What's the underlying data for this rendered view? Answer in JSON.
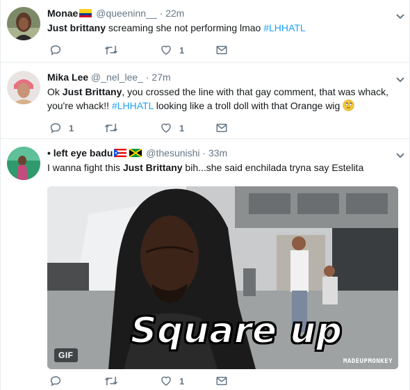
{
  "colors": {
    "accent": "#1da1f2",
    "secondary_text": "#657786",
    "divider": "#e6ecf0"
  },
  "tweets": [
    {
      "name": "Monae",
      "name_flag": "colombia-flag",
      "handle": "@queeninn__",
      "separator": "·",
      "time": "22m",
      "text_parts": [
        {
          "bold": "Just brittany"
        },
        {
          "plain": " screaming she not performing lmao "
        },
        {
          "hashtag": "#LHHATL"
        }
      ],
      "actions": {
        "reply_count": "",
        "retweet_count": "",
        "like_count": "1"
      }
    },
    {
      "name": "Mika Lee",
      "handle": "@_nel_lee_",
      "separator": "·",
      "time": "27m",
      "text_parts": [
        {
          "plain": "Ok "
        },
        {
          "bold": "Just Brittany"
        },
        {
          "plain": ", you crossed the line with that gay comment, that was whack, you're whack!! "
        },
        {
          "hashtag": "#LHHATL"
        },
        {
          "plain": " looking like a troll doll with that Orange wig "
        }
      ],
      "emoji": "face-with-rolling-eyes-emoji",
      "actions": {
        "reply_count": "1",
        "retweet_count": "",
        "like_count": "1"
      }
    },
    {
      "name": "• left eye badu",
      "name_flags": [
        "puerto-rico-flag",
        "jamaica-flag"
      ],
      "handle": "@thesunishi",
      "separator": "·",
      "time": "33m",
      "text_parts": [
        {
          "plain": "I wanna fight this "
        },
        {
          "bold": "Just Brittany"
        },
        {
          "plain": " bih...she said enchilada tryna say Estelita"
        }
      ],
      "media": {
        "type": "gif",
        "badge": "GIF",
        "caption": "Square up",
        "watermark": "MADEUPMONKEY"
      },
      "actions": {
        "reply_count": "",
        "retweet_count": "",
        "like_count": "1"
      }
    }
  ],
  "icons": {
    "reply": "reply-icon",
    "retweet": "retweet-icon",
    "like": "heart-icon",
    "dm": "envelope-icon",
    "caret": "chevron-down-icon"
  }
}
